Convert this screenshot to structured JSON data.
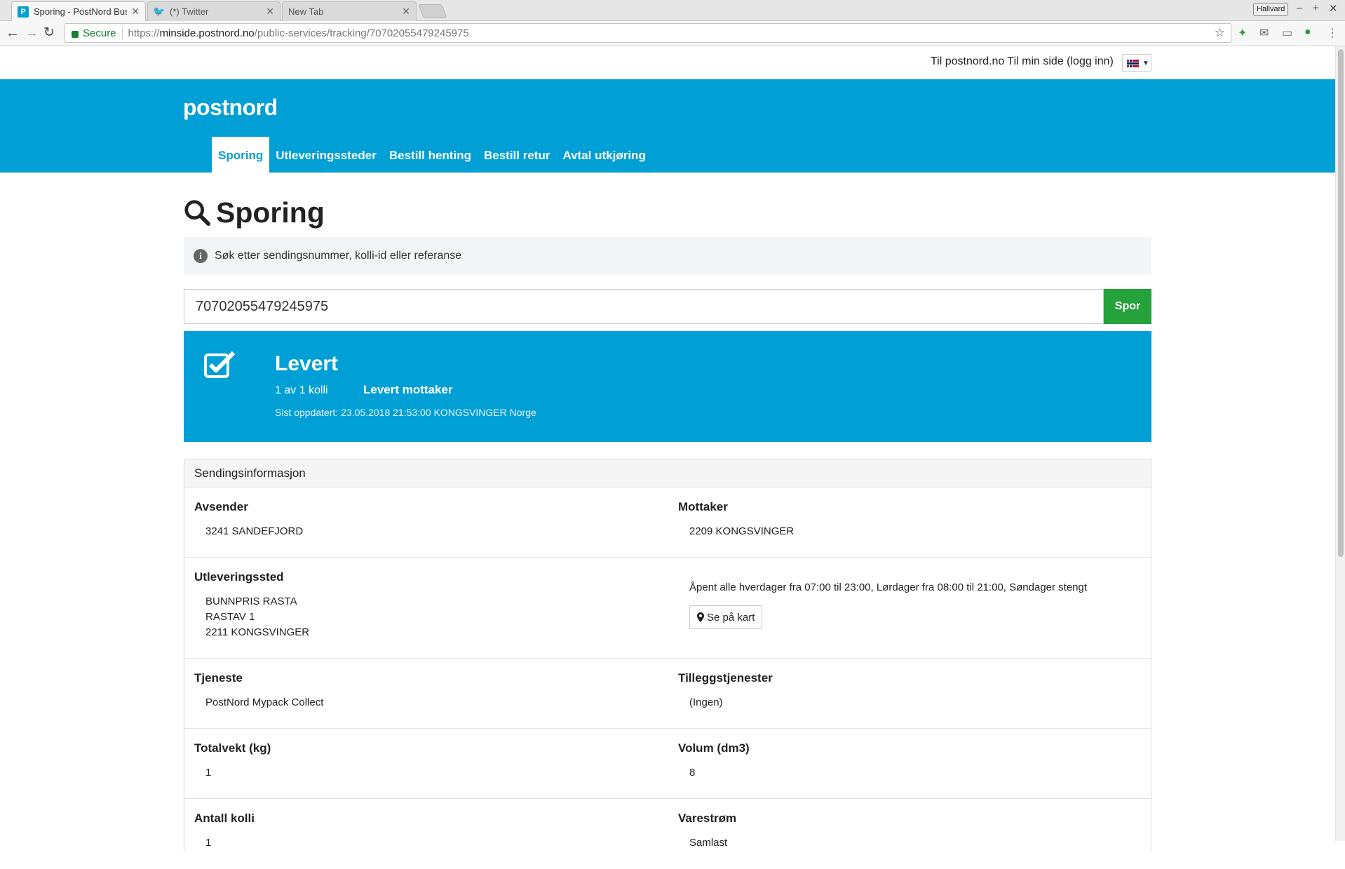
{
  "browser": {
    "tabs": [
      {
        "title": "Sporing - PostNord Bus",
        "active": true
      },
      {
        "title": "(*) Twitter",
        "active": false
      },
      {
        "title": "New Tab",
        "active": false
      }
    ],
    "profile": "Hallvard",
    "secure_label": "Secure",
    "url_scheme": "https://",
    "url_host": "minside.postnord.no",
    "url_path": "/public-services/tracking/70702055479245975"
  },
  "topbar": {
    "links": "Til postnord.no Til min side (logg inn)"
  },
  "header": {
    "logo": "postnord",
    "nav": [
      {
        "label": "Sporing",
        "active": true
      },
      {
        "label": "Utleveringssteder",
        "active": false
      },
      {
        "label": "Bestill henting",
        "active": false
      },
      {
        "label": "Bestill retur",
        "active": false
      },
      {
        "label": "Avtal utkjøring",
        "active": false
      }
    ]
  },
  "page": {
    "title": "Sporing",
    "info": "Søk etter sendingsnummer, kolli-id eller referanse",
    "search_value": "70702055479245975",
    "search_button": "Spor"
  },
  "status": {
    "title": "Levert",
    "count": "1 av 1 kolli",
    "detail": "Levert mottaker",
    "updated": "Sist oppdatert: 23.05.2018 21:53:00 KONGSVINGER Norge"
  },
  "shipment": {
    "heading": "Sendingsinformasjon",
    "avsender_label": "Avsender",
    "avsender": "3241 SANDEFJORD",
    "mottaker_label": "Mottaker",
    "mottaker": "2209 KONGSVINGER",
    "utlev_label": "Utleveringssted",
    "utlev_line1": "BUNNPRIS RASTA",
    "utlev_line2": "RASTAV 1",
    "utlev_line3": "2211 KONGSVINGER",
    "hours": "Åpent alle hverdager fra 07:00 til 23:00, Lørdager fra 08:00 til 21:00, Søndager stengt",
    "map_button": "Se på kart",
    "tjeneste_label": "Tjeneste",
    "tjeneste": "PostNord Mypack Collect",
    "tillegg_label": "Tilleggstjenester",
    "tillegg": "(Ingen)",
    "vekt_label": "Totalvekt (kg)",
    "vekt": "1",
    "volum_label": "Volum (dm3)",
    "volum": "8",
    "kolli_label": "Antall kolli",
    "kolli": "1",
    "varestrom_label": "Varestrøm",
    "varestrom": "Samlast"
  }
}
